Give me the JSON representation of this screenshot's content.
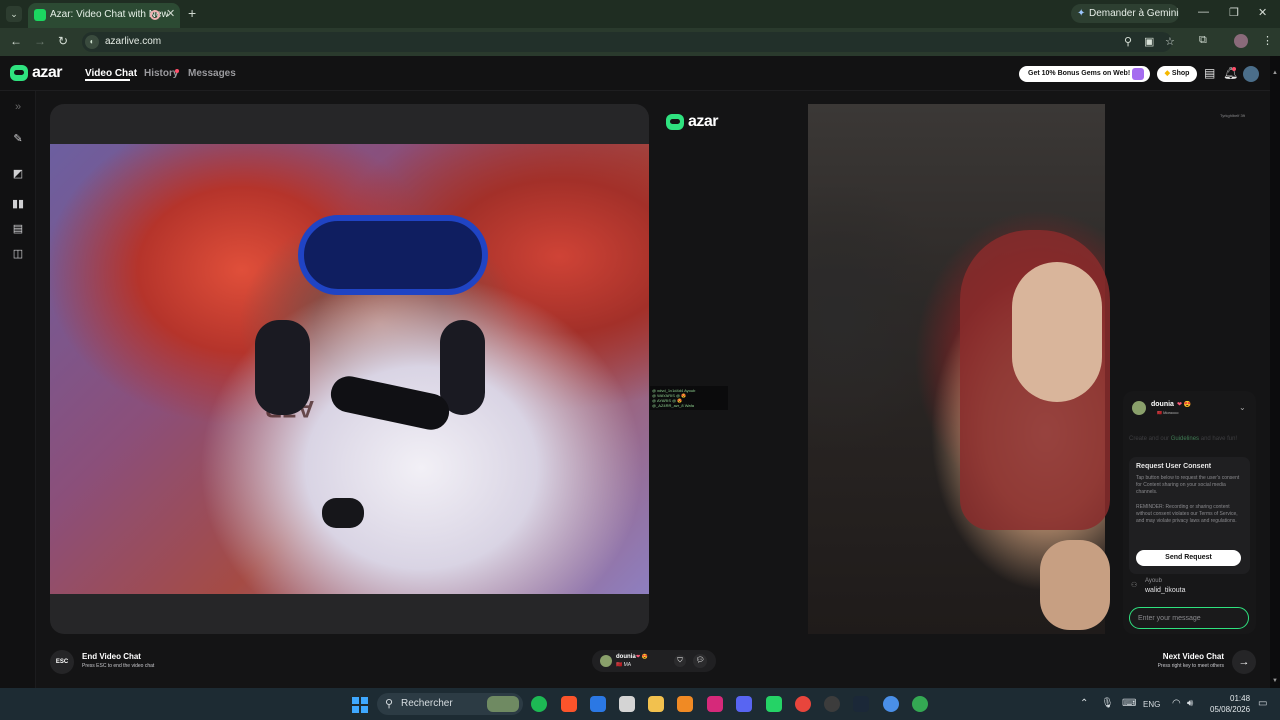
{
  "browser": {
    "tab_title": "Azar: Video Chat with New",
    "new_tab": "+",
    "gemini_label": "Demander à Gemini",
    "url": "azarlive.com"
  },
  "header": {
    "logo": "azar",
    "nav": [
      "Video Chat",
      "History",
      "Messages"
    ],
    "gems_label": "Get 10% Bonus Gems on Web!",
    "shop_label": "Shop"
  },
  "stage": {
    "watermark": "azar",
    "shirt_print": "AZR",
    "overlay_lines": [
      "@ xdvd_1v1d4d4 Ayoub",
      "@ WAYARIS @ 😍",
      "@ AYARIS @ 😍",
      "@_AZ4RR_azr_8 Wafa"
    ],
    "corner_tag": "Tyrkghlbelf 3ft"
  },
  "chat": {
    "partner_name": "dounia",
    "partner_badges": "❤ 😍",
    "partner_sub": "🇲🇦 Morocco",
    "guideline_prefix": "Create and our",
    "guideline_link": "Guidelines",
    "guideline_suffix": "and have fun!",
    "consent_title": "Request User Consent",
    "consent_body_1": "Tap button below to request the user's consent for Content sharing on your social media channels.",
    "consent_body_2": "REMINDER: Recording or sharing content without consent violates our Terms of Service, and may violate privacy laws and regulations.",
    "send_request_label": "Send Request",
    "message_from": "Ayoub",
    "message_text": "walid_tikouta",
    "input_placeholder": "Enter your message"
  },
  "controls": {
    "esc_label": "ESC",
    "end_title": "End Video Chat",
    "end_sub": "Press ESC to end the video chat",
    "partner_name": "dounia",
    "partner_hearts": "❤ 😍",
    "partner_flag": "🇲🇦 MA",
    "next_title": "Next Video Chat",
    "next_sub": "Press right key to meet others"
  },
  "taskbar": {
    "search_label": "Rechercher",
    "lang": "ENG",
    "time": "01:48",
    "date": "05/08/2026"
  },
  "colors": {
    "accent": "#2fe27f",
    "notification": "#ff4f6a"
  }
}
